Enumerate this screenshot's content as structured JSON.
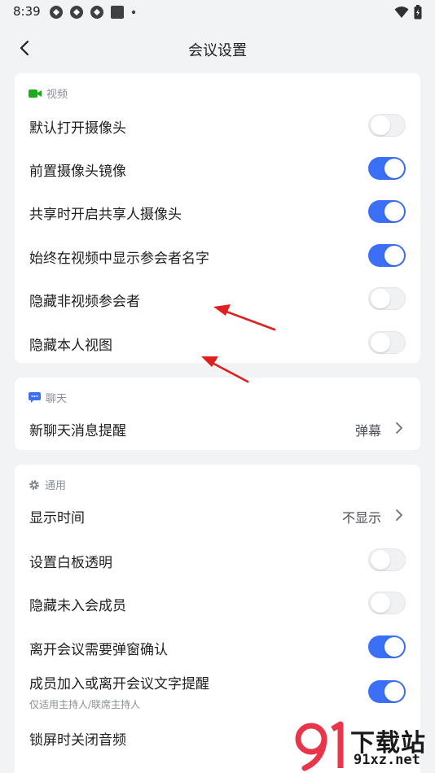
{
  "status_bar": {
    "time": "8:39",
    "icons": [
      "app-notification-icon",
      "app-notification-icon",
      "app-notification-icon",
      "image-notification-icon",
      "dot-icon",
      "wifi-icon",
      "battery-icon"
    ]
  },
  "header": {
    "title": "会议设置",
    "back_icon": "back-arrow-icon"
  },
  "sections": {
    "video": {
      "title": "视频",
      "icon": "video-camera-icon",
      "icon_color": "#1aad19",
      "rows": [
        {
          "label": "默认打开摄像头",
          "on": false
        },
        {
          "label": "前置摄像头镜像",
          "on": true
        },
        {
          "label": "共享时开启共享人摄像头",
          "on": true
        },
        {
          "label": "始终在视频中显示参会者名字",
          "on": true
        },
        {
          "label": "隐藏非视频参会者",
          "on": false
        },
        {
          "label": "隐藏本人视图",
          "on": false
        }
      ]
    },
    "chat": {
      "title": "聊天",
      "icon": "chat-bubble-icon",
      "icon_color": "#3b6ff5",
      "rows": [
        {
          "label": "新聊天消息提醒",
          "value": "弹幕"
        }
      ]
    },
    "general": {
      "title": "通用",
      "icon": "gear-icon",
      "icon_color": "#7a7f88",
      "rows": [
        {
          "label": "显示时间",
          "value": "不显示"
        },
        {
          "label": "设置白板透明",
          "on": false
        },
        {
          "label": "隐藏未入会成员",
          "on": false
        },
        {
          "label": "离开会议需要弹窗确认",
          "on": true
        },
        {
          "label": "成员加入或离开会议文字提醒",
          "sub": "仅适用主持人/联席主持人",
          "on": true
        },
        {
          "label": "锁屏时关闭音频"
        }
      ]
    }
  },
  "annotations": {
    "arrow_color": "#e02020",
    "arrow_icon": "red-arrow-icon"
  },
  "watermark": {
    "line1": "下载站",
    "line2": "91xz.net",
    "logo": "91-logo-icon",
    "logo_color": "#e8354a"
  },
  "colors": {
    "toggle_on": "#3b6ff5",
    "toggle_off": "#f0f1f3",
    "background": "#f2f3f5",
    "card": "#ffffff"
  }
}
